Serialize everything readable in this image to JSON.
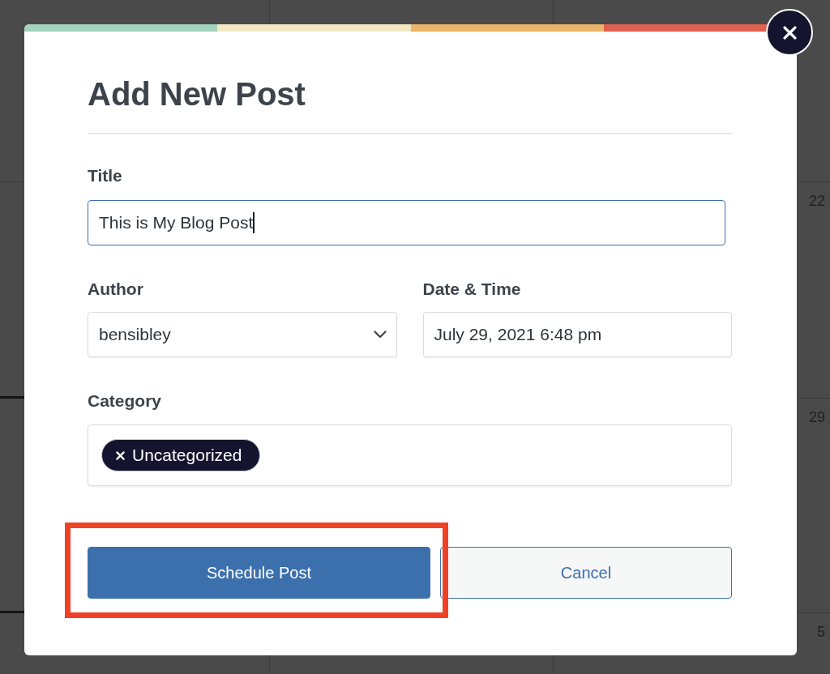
{
  "calendar": {
    "day_numbers": [
      "22",
      "29",
      "5"
    ]
  },
  "dialog": {
    "title": "Add New Post",
    "title_field": {
      "label": "Title",
      "value": "This is My Blog Post",
      "focused": true
    },
    "author_field": {
      "label": "Author",
      "value": "bensibley"
    },
    "date_field": {
      "label": "Date & Time",
      "value": "July 29, 2021 6:48 pm"
    },
    "category_field": {
      "label": "Category",
      "tags": [
        {
          "label": "Uncategorized"
        }
      ]
    },
    "buttons": [
      {
        "label": "Schedule Post",
        "kind": "primary",
        "highlighted": true
      },
      {
        "label": "Cancel",
        "kind": "secondary",
        "highlighted": false
      }
    ]
  }
}
